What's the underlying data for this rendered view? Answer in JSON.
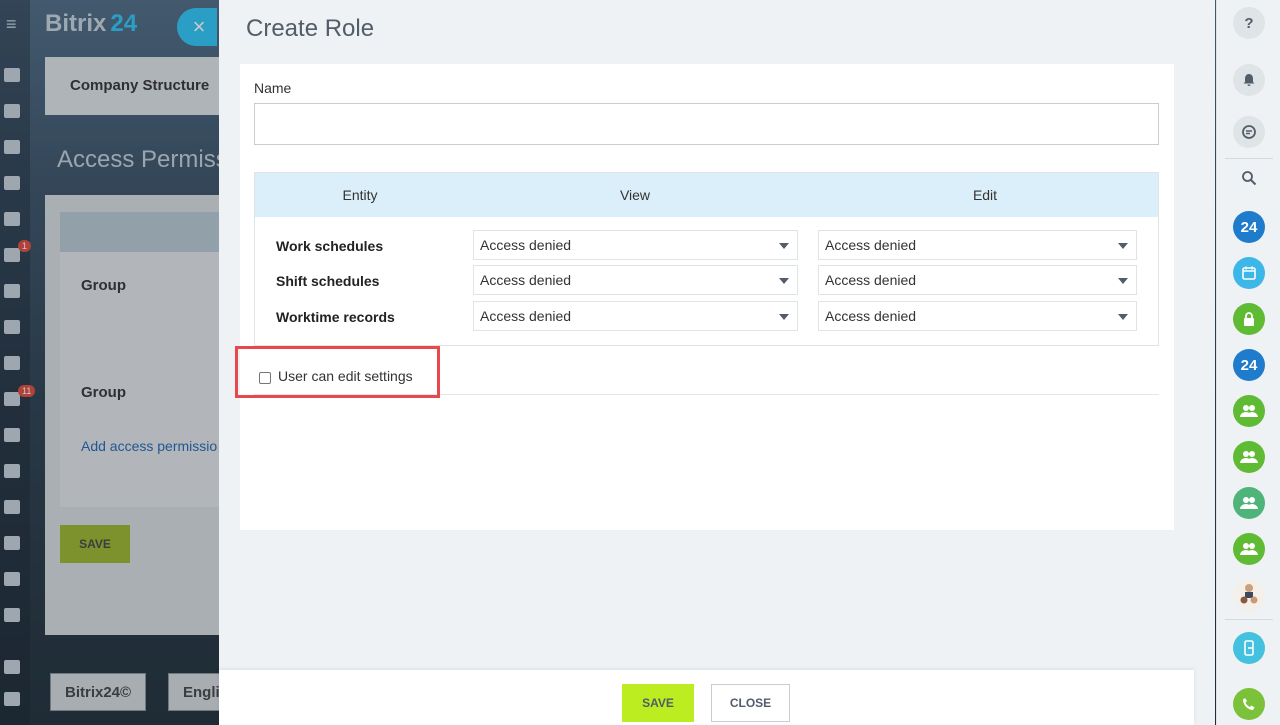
{
  "background": {
    "logo": "Bitrix",
    "logo_suffix": "24",
    "close_icon": "×",
    "menu_icon": "≡",
    "tab_label": "Company Structure",
    "page_title": "Access Permiss",
    "group_1": "Group",
    "group_2": "Group",
    "add_link": "Add access permissio",
    "save": "SAVE",
    "footer_brand": "Bitrix24©",
    "footer_lang": "Englis",
    "badges": [
      "1",
      "11"
    ]
  },
  "slider": {
    "title": "Create Role",
    "name_label": "Name",
    "name_value": "",
    "table": {
      "headers": {
        "entity": "Entity",
        "view": "View",
        "edit": "Edit"
      },
      "rows": [
        {
          "entity": "Work schedules",
          "view": "Access denied",
          "edit": "Access denied"
        },
        {
          "entity": "Shift schedules",
          "view": "Access denied",
          "edit": "Access denied"
        },
        {
          "entity": "Worktime records",
          "view": "Access denied",
          "edit": "Access denied"
        }
      ]
    },
    "checkbox_label": "User can edit settings",
    "checkbox_checked": false,
    "save_label": "SAVE",
    "close_label": "CLOSE"
  },
  "right_bar": {
    "help": "?",
    "search": "⚲",
    "b24_1": "24",
    "b24_2": "24"
  },
  "colors": {
    "accent_green": "#bbed21",
    "highlight_red": "#e8474b",
    "header_blue": "#dbeffa"
  }
}
